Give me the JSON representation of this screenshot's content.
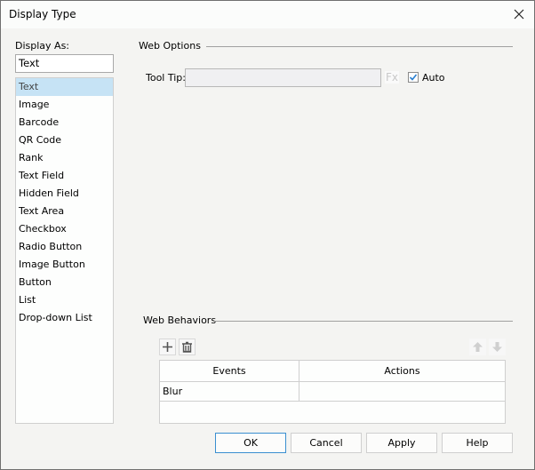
{
  "window": {
    "title": "Display Type",
    "close_icon": "close-icon"
  },
  "display_as": {
    "label": "Display As:",
    "value": "Text",
    "items": [
      {
        "label": "Text",
        "selected": true
      },
      {
        "label": "Image"
      },
      {
        "label": "Barcode"
      },
      {
        "label": "QR Code"
      },
      {
        "label": "Rank"
      },
      {
        "label": "Text Field"
      },
      {
        "label": "Hidden Field"
      },
      {
        "label": "Text Area"
      },
      {
        "label": "Checkbox"
      },
      {
        "label": "Radio Button"
      },
      {
        "label": "Image Button"
      },
      {
        "label": "Button"
      },
      {
        "label": "List"
      },
      {
        "label": "Drop-down List"
      }
    ]
  },
  "web_options": {
    "title": "Web Options",
    "tooltip_label": "Tool Tip:",
    "tooltip_value": "",
    "fx_label": "Fx",
    "auto_label": "Auto",
    "auto_checked": true
  },
  "web_behaviors": {
    "title": "Web Behaviors",
    "toolbar": {
      "add_icon": "plus-icon",
      "delete_icon": "trash-icon",
      "up_icon": "arrow-up-icon",
      "down_icon": "arrow-down-icon"
    },
    "columns": [
      "Events",
      "Actions"
    ],
    "rows": [
      {
        "event": "Blur",
        "action": ""
      }
    ]
  },
  "buttons": {
    "ok": "OK",
    "cancel": "Cancel",
    "apply": "Apply",
    "help": "Help"
  },
  "colors": {
    "selection": "#c6e3f5",
    "default_button_border": "#3a8fd0",
    "checkmark": "#2a7fd0"
  }
}
